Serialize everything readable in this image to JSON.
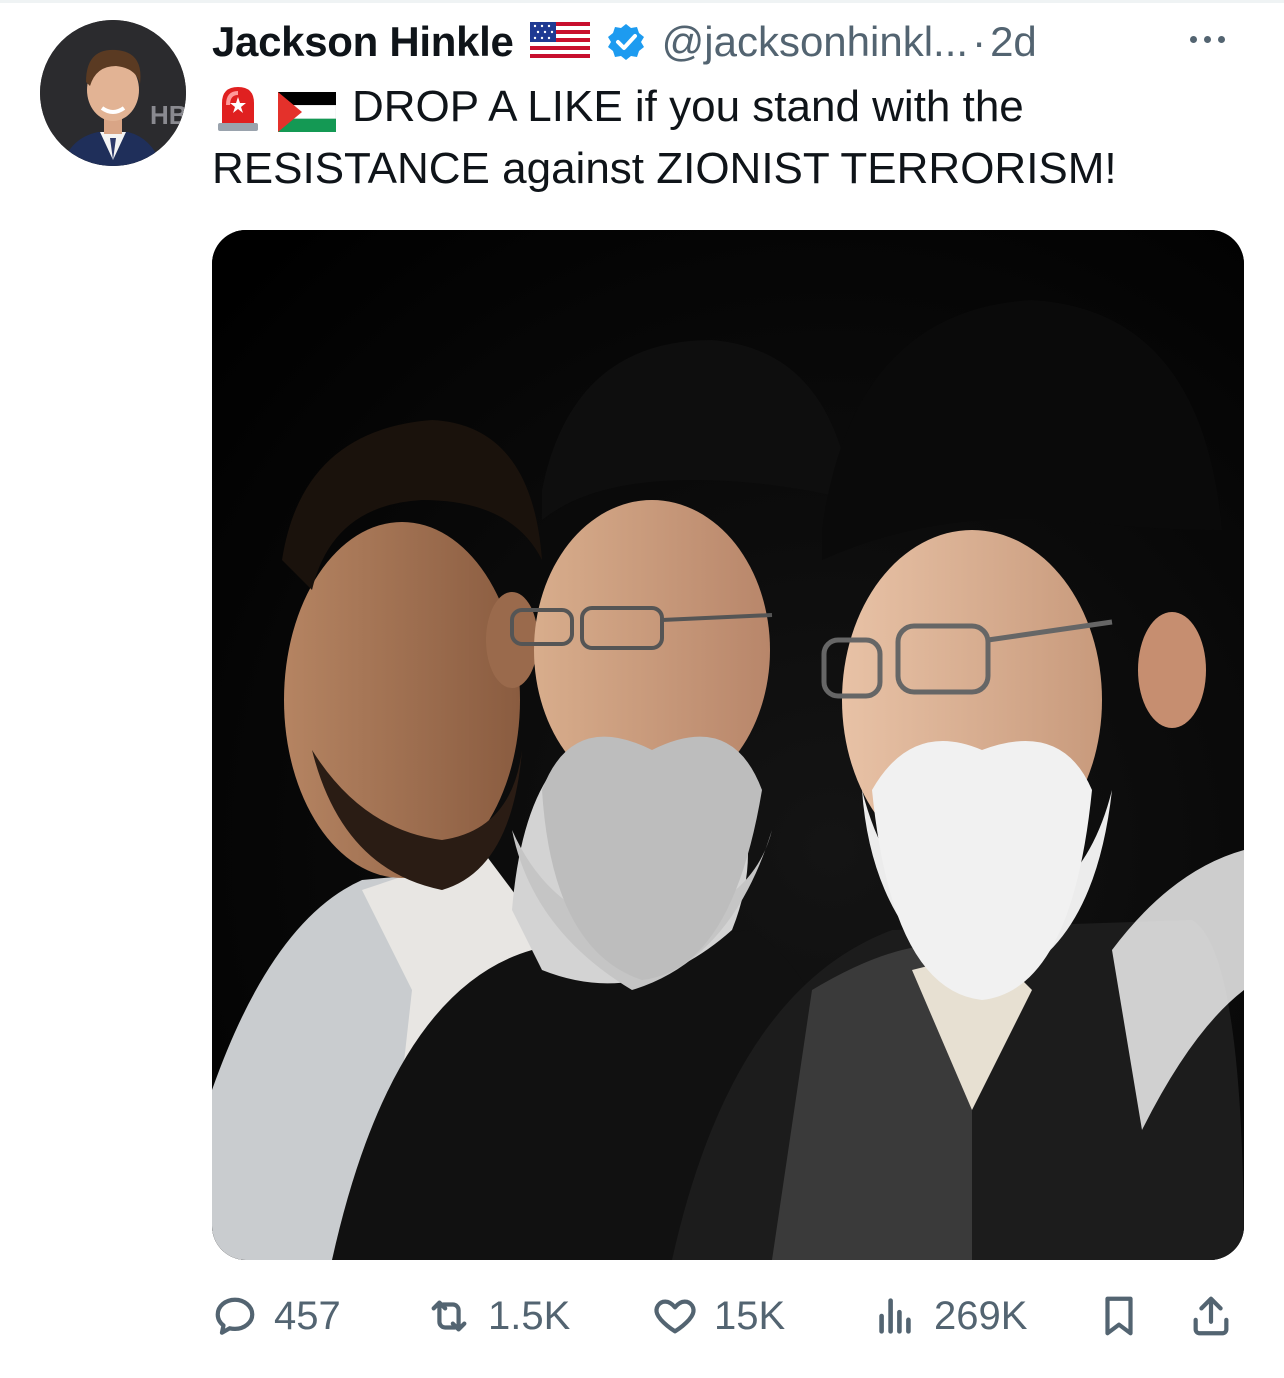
{
  "tweet": {
    "author_name": "Jackson Hinkle",
    "handle": "@jacksonhinkl...",
    "separator": "·",
    "time": "2d",
    "avatar_badge": "HB",
    "text_line1": "DROP A LIKE if you stand with the",
    "text_line2": "RESISTANCE against ZIONIST TERRORISM!",
    "emojis": [
      "rotating-light-icon",
      "palestine-flag-icon"
    ],
    "author_flag": "us-flag-icon",
    "verified": true,
    "accent_color": "#1d9bf0"
  },
  "stats": {
    "replies": "457",
    "reposts": "1.5K",
    "likes": "15K",
    "views": "269K"
  },
  "colors": {
    "text": "#0f1419",
    "secondary": "#536471",
    "verified_blue": "#1d9bf0",
    "background": "#ffffff"
  }
}
